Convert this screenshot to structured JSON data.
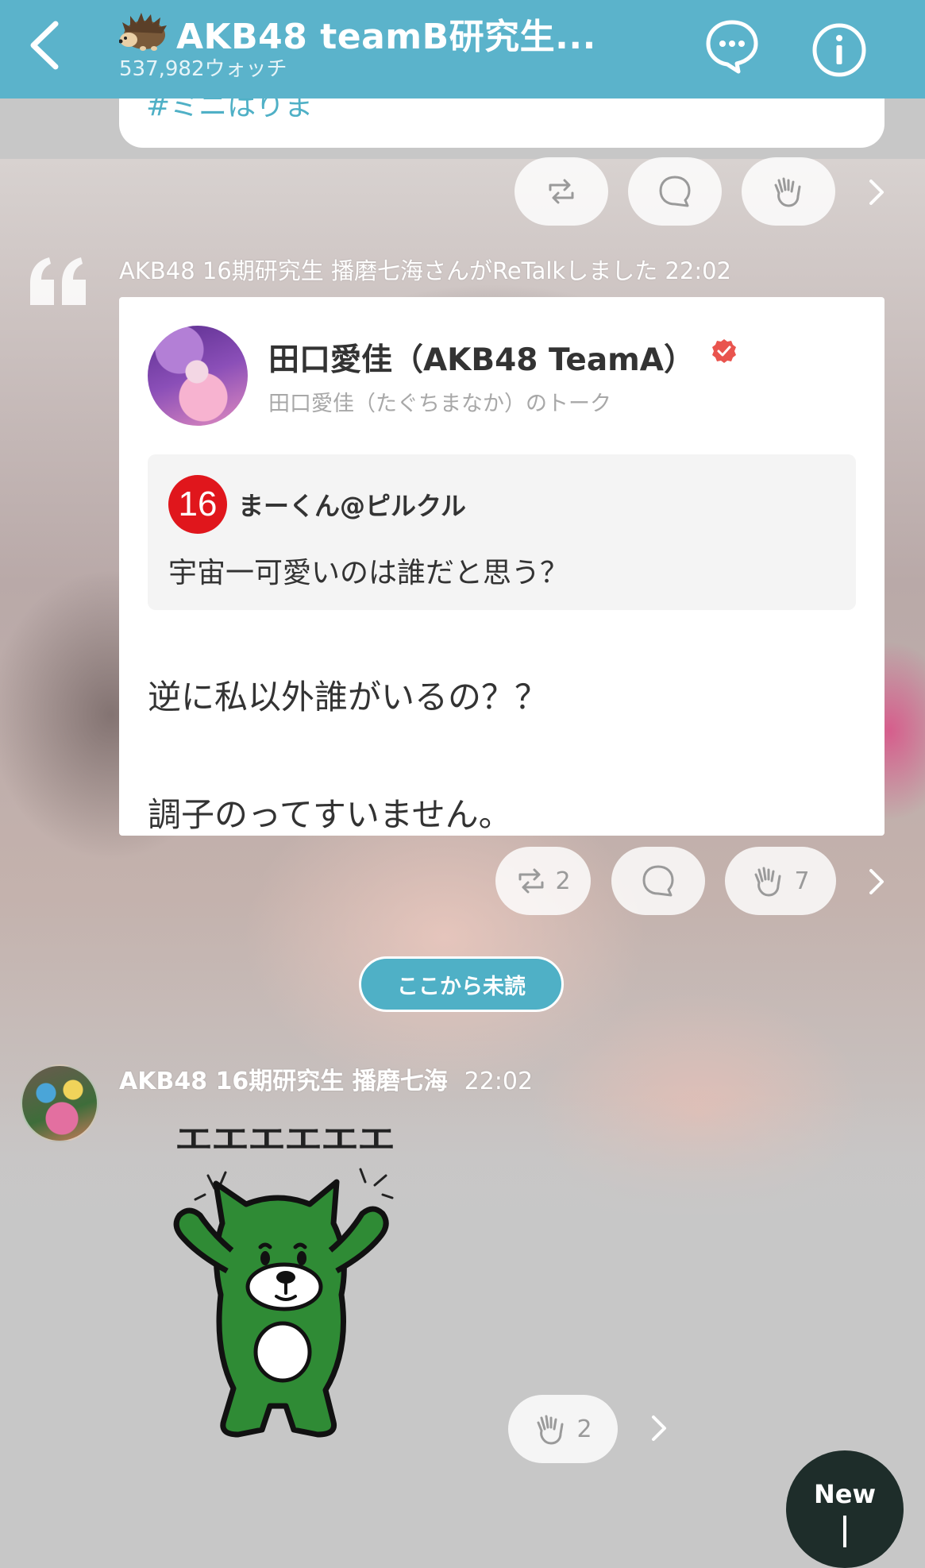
{
  "header": {
    "title": "AKB48 teamB研究生...",
    "watch_count": "537,982ウォッチ",
    "back_icon": "chevron-left-icon",
    "room_icon": "hedgehog-icon",
    "chat_icon": "chat-bubble-icon",
    "info_icon": "info-icon",
    "bg_color": "#5bb3cb"
  },
  "top_card": {
    "text": "#ミニはりま"
  },
  "first_actions": {
    "retalk_icon": "retalk-icon",
    "comment_icon": "comment-icon",
    "clap_icon": "clap-icon"
  },
  "retalk": {
    "meta": "AKB48 16期研究生  播磨七海さんがReTalkしました  22:02",
    "poster_name": "田口愛佳（AKB48 TeamA）",
    "verified_icon": "verified-check-icon",
    "talk_name": "田口愛佳（たぐちまなか）のトーク",
    "quoted": {
      "badge": "16",
      "user": "まーくん@ピルクル",
      "text": "宇宙一可愛いのは誰だと思う？"
    },
    "reply_line1": "逆に私以外誰がいるの？？",
    "reply_line2": "調子のってすいません。",
    "retalk_count": "2",
    "clap_count": "7"
  },
  "unread_label": "ここから未読",
  "post": {
    "author": "AKB48 16期研究生  播磨七海",
    "time": "22:02",
    "sticker_text": "エエエエエエ",
    "sticker_icon": "green-bear-sticker",
    "clap_count": "2"
  },
  "new_button": {
    "label": "New"
  },
  "colors": {
    "accent": "#5bb3cb",
    "badge_red": "#e0161c",
    "verified": "#e9544e"
  }
}
